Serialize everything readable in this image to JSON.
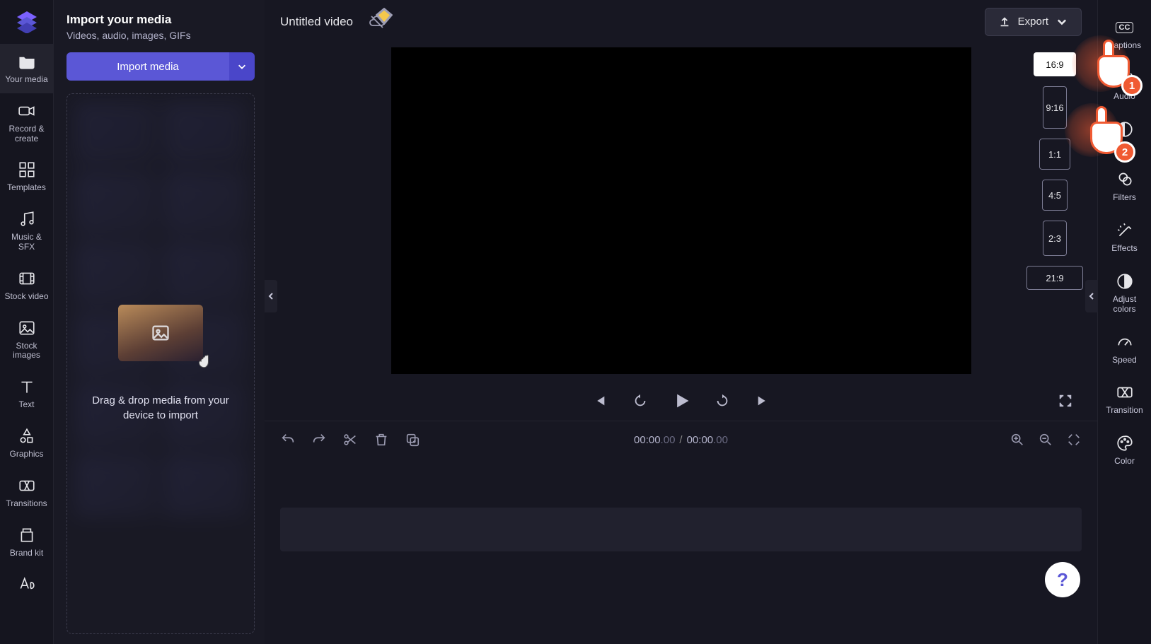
{
  "project_title": "Untitled video",
  "export_label": "Export",
  "rail": [
    {
      "id": "your-media",
      "label": "Your media"
    },
    {
      "id": "record-create",
      "label": "Record &\ncreate"
    },
    {
      "id": "templates",
      "label": "Templates"
    },
    {
      "id": "music-sfx",
      "label": "Music & SFX"
    },
    {
      "id": "stock-video",
      "label": "Stock video"
    },
    {
      "id": "stock-images",
      "label": "Stock\nimages"
    },
    {
      "id": "text",
      "label": "Text"
    },
    {
      "id": "graphics",
      "label": "Graphics"
    },
    {
      "id": "transitions",
      "label": "Transitions"
    },
    {
      "id": "brand-kit",
      "label": "Brand kit"
    }
  ],
  "panel": {
    "title": "Import your media",
    "subtitle": "Videos, audio, images, GIFs",
    "import_label": "Import media",
    "drop_text": "Drag & drop media from your device to import"
  },
  "aspect_ratios": [
    {
      "label": "16:9",
      "class": "ratio-16-9",
      "active": true
    },
    {
      "label": "9:16",
      "class": "ratio-9-16",
      "active": false
    },
    {
      "label": "1:1",
      "class": "ratio-1-1",
      "active": false
    },
    {
      "label": "4:5",
      "class": "ratio-4-5",
      "active": false
    },
    {
      "label": "2:3",
      "class": "ratio-2-3",
      "active": false
    },
    {
      "label": "21:9",
      "class": "ratio-21-9",
      "active": false
    }
  ],
  "props": [
    {
      "id": "captions",
      "label": "Captions"
    },
    {
      "id": "audio",
      "label": "Audio"
    },
    {
      "id": "fade",
      "label": "Fade"
    },
    {
      "id": "filters",
      "label": "Filters"
    },
    {
      "id": "effects",
      "label": "Effects"
    },
    {
      "id": "adjust-colors",
      "label": "Adjust\ncolors"
    },
    {
      "id": "speed",
      "label": "Speed"
    },
    {
      "id": "transition",
      "label": "Transition"
    },
    {
      "id": "color",
      "label": "Color"
    }
  ],
  "time": {
    "current_sec": "00:00",
    "current_ms": ".00",
    "total_sec": "00:00",
    "total_ms": ".00"
  },
  "help_glyph": "?",
  "annotations": {
    "step1": "1",
    "step2": "2"
  }
}
